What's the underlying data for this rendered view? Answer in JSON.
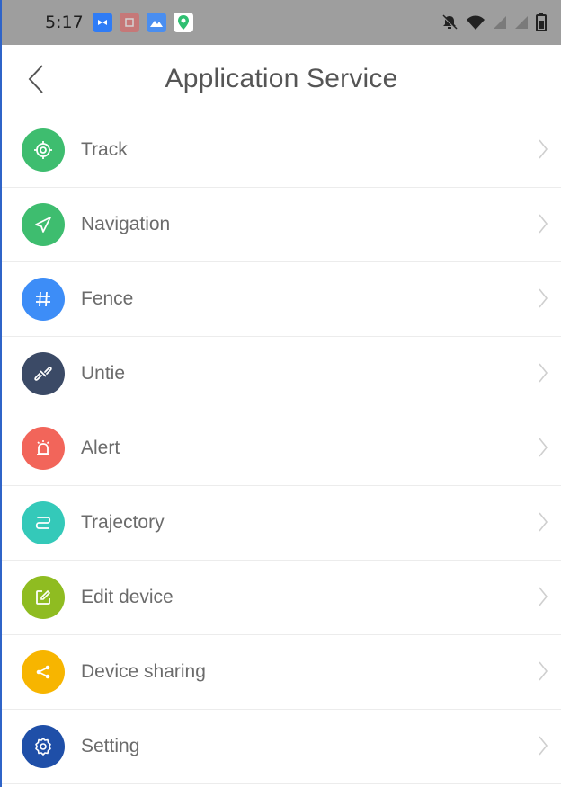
{
  "status_bar": {
    "time": "5:17",
    "app_icons": [
      {
        "name": "app-icon-blue-chain",
        "color": "#2f7cf6"
      },
      {
        "name": "app-icon-red",
        "color": "#e85a5a"
      },
      {
        "name": "app-icon-mountain",
        "color": "#4a8ef0"
      },
      {
        "name": "app-icon-location-pin",
        "color": "#2fbf71"
      }
    ],
    "system_icons": [
      "notifications-off-icon",
      "wifi-icon",
      "signal-icon",
      "signal-icon",
      "battery-icon"
    ]
  },
  "header": {
    "title": "Application Service",
    "back_icon": "chevron-left-icon"
  },
  "menu": {
    "items": [
      {
        "label": "Track",
        "icon": "target-icon",
        "color": "#3ebd6f"
      },
      {
        "label": "Navigation",
        "icon": "send-icon",
        "color": "#3ebd6f"
      },
      {
        "label": "Fence",
        "icon": "hash-icon",
        "color": "#3d8df7"
      },
      {
        "label": "Untie",
        "icon": "unlink-icon",
        "color": "#3b4a66"
      },
      {
        "label": "Alert",
        "icon": "alarm-icon",
        "color": "#f2655a"
      },
      {
        "label": "Trajectory",
        "icon": "route-icon",
        "color": "#34c9b9"
      },
      {
        "label": "Edit device",
        "icon": "edit-icon",
        "color": "#8fbc21"
      },
      {
        "label": "Device sharing",
        "icon": "share-icon",
        "color": "#f7b500"
      },
      {
        "label": "Setting",
        "icon": "gear-icon",
        "color": "#1f4fa8"
      }
    ]
  }
}
